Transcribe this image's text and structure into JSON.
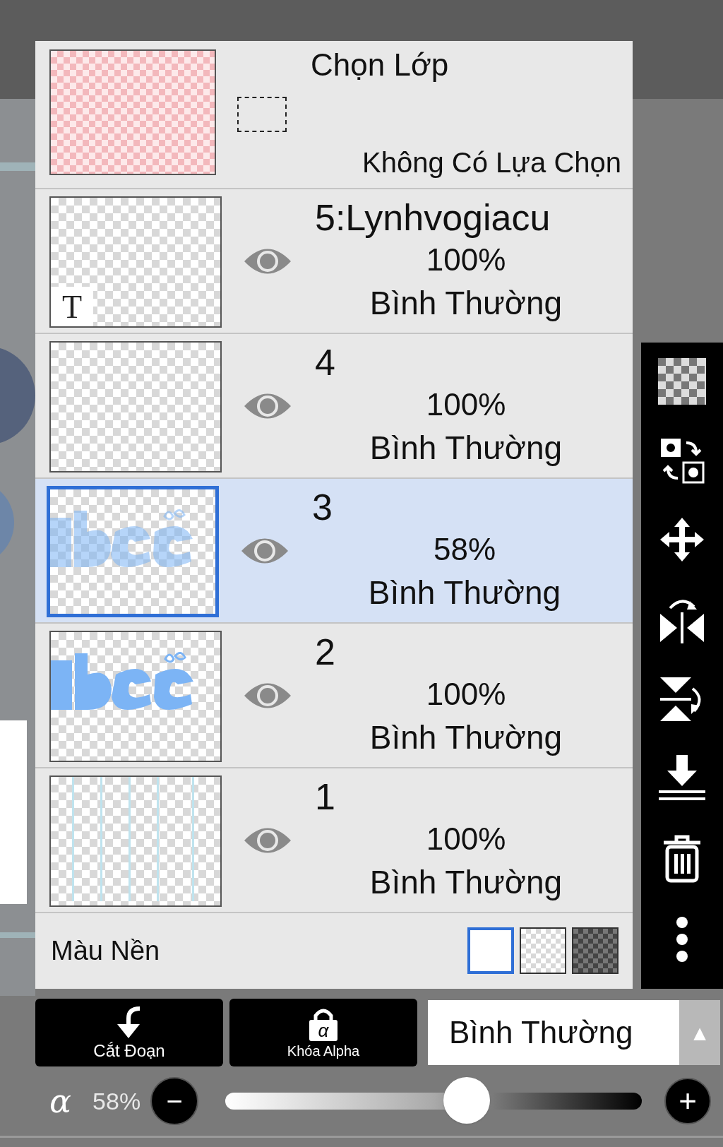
{
  "selection_layer": {
    "title": "Chọn Lớp",
    "subtitle": "Không Có Lựa Chọn"
  },
  "layers": [
    {
      "name": "5:Lynhvogiacu",
      "opacity": "100%",
      "mode": "Bình Thường",
      "selected": false,
      "visible": true,
      "kind": "text",
      "badge": "T"
    },
    {
      "name": "4",
      "opacity": "100%",
      "mode": "Bình Thường",
      "selected": false,
      "visible": true,
      "kind": "blank"
    },
    {
      "name": "3",
      "opacity": "58%",
      "mode": "Bình Thường",
      "selected": true,
      "visible": true,
      "kind": "faded"
    },
    {
      "name": "2",
      "opacity": "100%",
      "mode": "Bình Thường",
      "selected": false,
      "visible": true,
      "kind": "lettering"
    },
    {
      "name": "1",
      "opacity": "100%",
      "mode": "Bình Thường",
      "selected": false,
      "visible": true,
      "kind": "lines"
    }
  ],
  "background_color": {
    "label": "Màu Nền",
    "options": [
      {
        "kind": "white",
        "selected": true
      },
      {
        "kind": "transparent",
        "selected": false
      },
      {
        "kind": "dark",
        "selected": false
      }
    ]
  },
  "buttons": [
    {
      "kind": "clip",
      "label": "Cắt Đoạn"
    },
    {
      "kind": "alpha-lock",
      "label": "Khóa Alpha",
      "icon_text": "α"
    }
  ],
  "blend_mode": {
    "value": "Bình Thường",
    "arrow": "▲"
  },
  "alpha": {
    "label": "α",
    "reading": "58%",
    "level": 0.58,
    "minus": "−",
    "plus": "+"
  }
}
